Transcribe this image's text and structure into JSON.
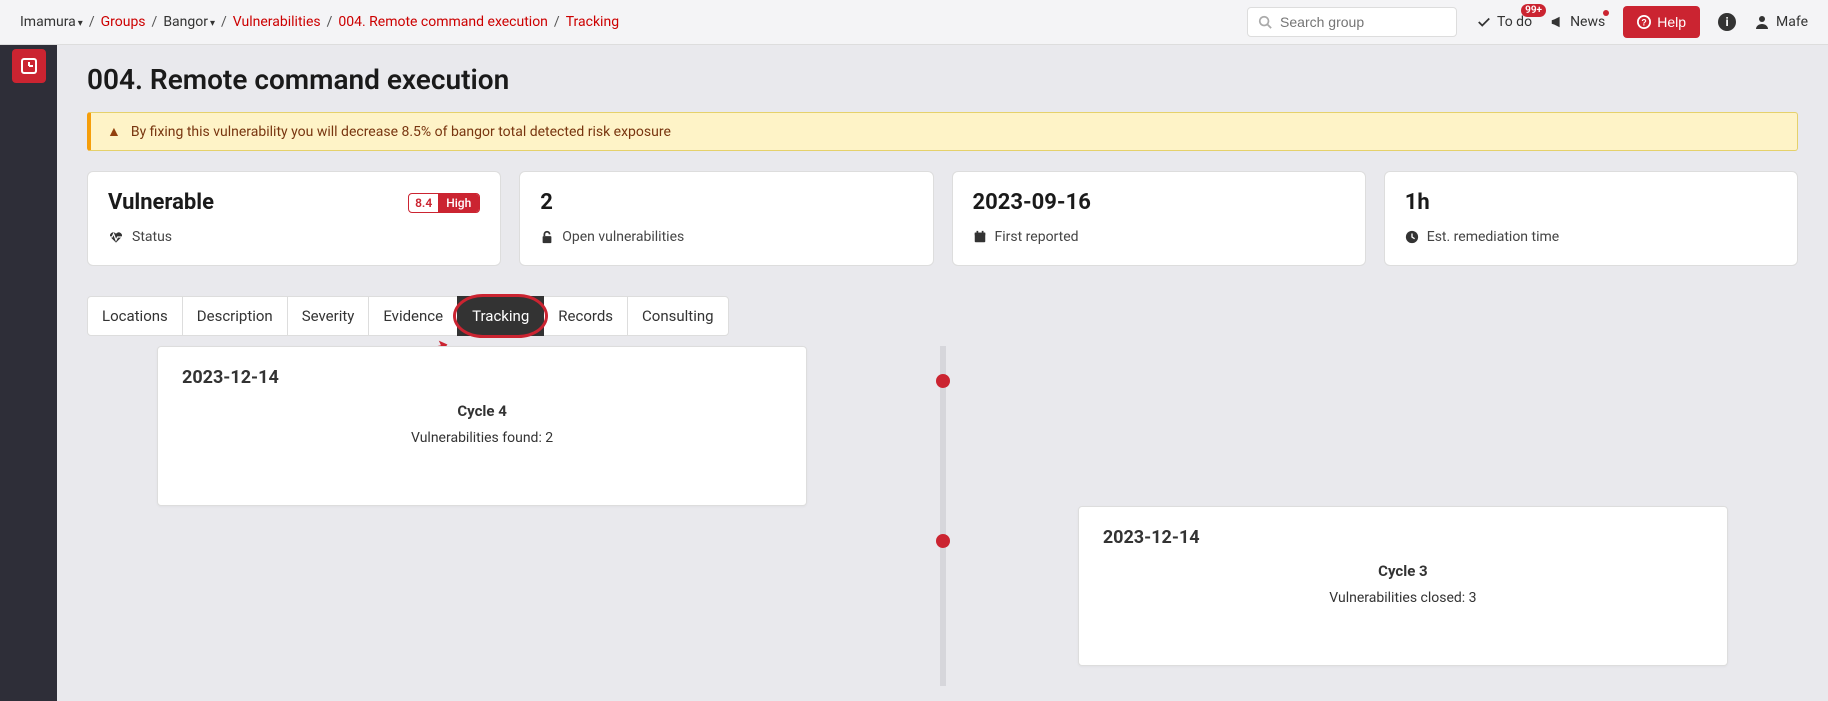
{
  "breadcrumb": {
    "org": "Imamura",
    "groups": "Groups",
    "group": "Bangor",
    "section": "Vulnerabilities",
    "finding": "004. Remote command execution",
    "current": "Tracking"
  },
  "search": {
    "placeholder": "Search group"
  },
  "top": {
    "todo": "To do",
    "todo_badge": "99+",
    "news": "News",
    "help": "Help",
    "user": "Mafe"
  },
  "page": {
    "title": "004. Remote command execution"
  },
  "alert": {
    "message": "By fixing this vulnerability you will decrease 8.5% of bangor total detected risk exposure"
  },
  "stats": {
    "status": {
      "value": "Vulnerable",
      "label": "Status",
      "severity_num": "8.4",
      "severity_label": "High"
    },
    "open": {
      "value": "2",
      "label": "Open vulnerabilities"
    },
    "first": {
      "value": "2023-09-16",
      "label": "First reported"
    },
    "eta": {
      "value": "1h",
      "label": "Est. remediation time"
    }
  },
  "tabs": {
    "locations": "Locations",
    "description": "Description",
    "severity": "Severity",
    "evidence": "Evidence",
    "tracking": "Tracking",
    "records": "Records",
    "consulting": "Consulting"
  },
  "timeline": {
    "item0": {
      "date": "2023-12-14",
      "cycle": "Cycle 4",
      "detail": "Vulnerabilities found: 2"
    },
    "item1": {
      "date": "2023-12-14",
      "cycle": "Cycle 3",
      "detail": "Vulnerabilities closed: 3"
    }
  }
}
